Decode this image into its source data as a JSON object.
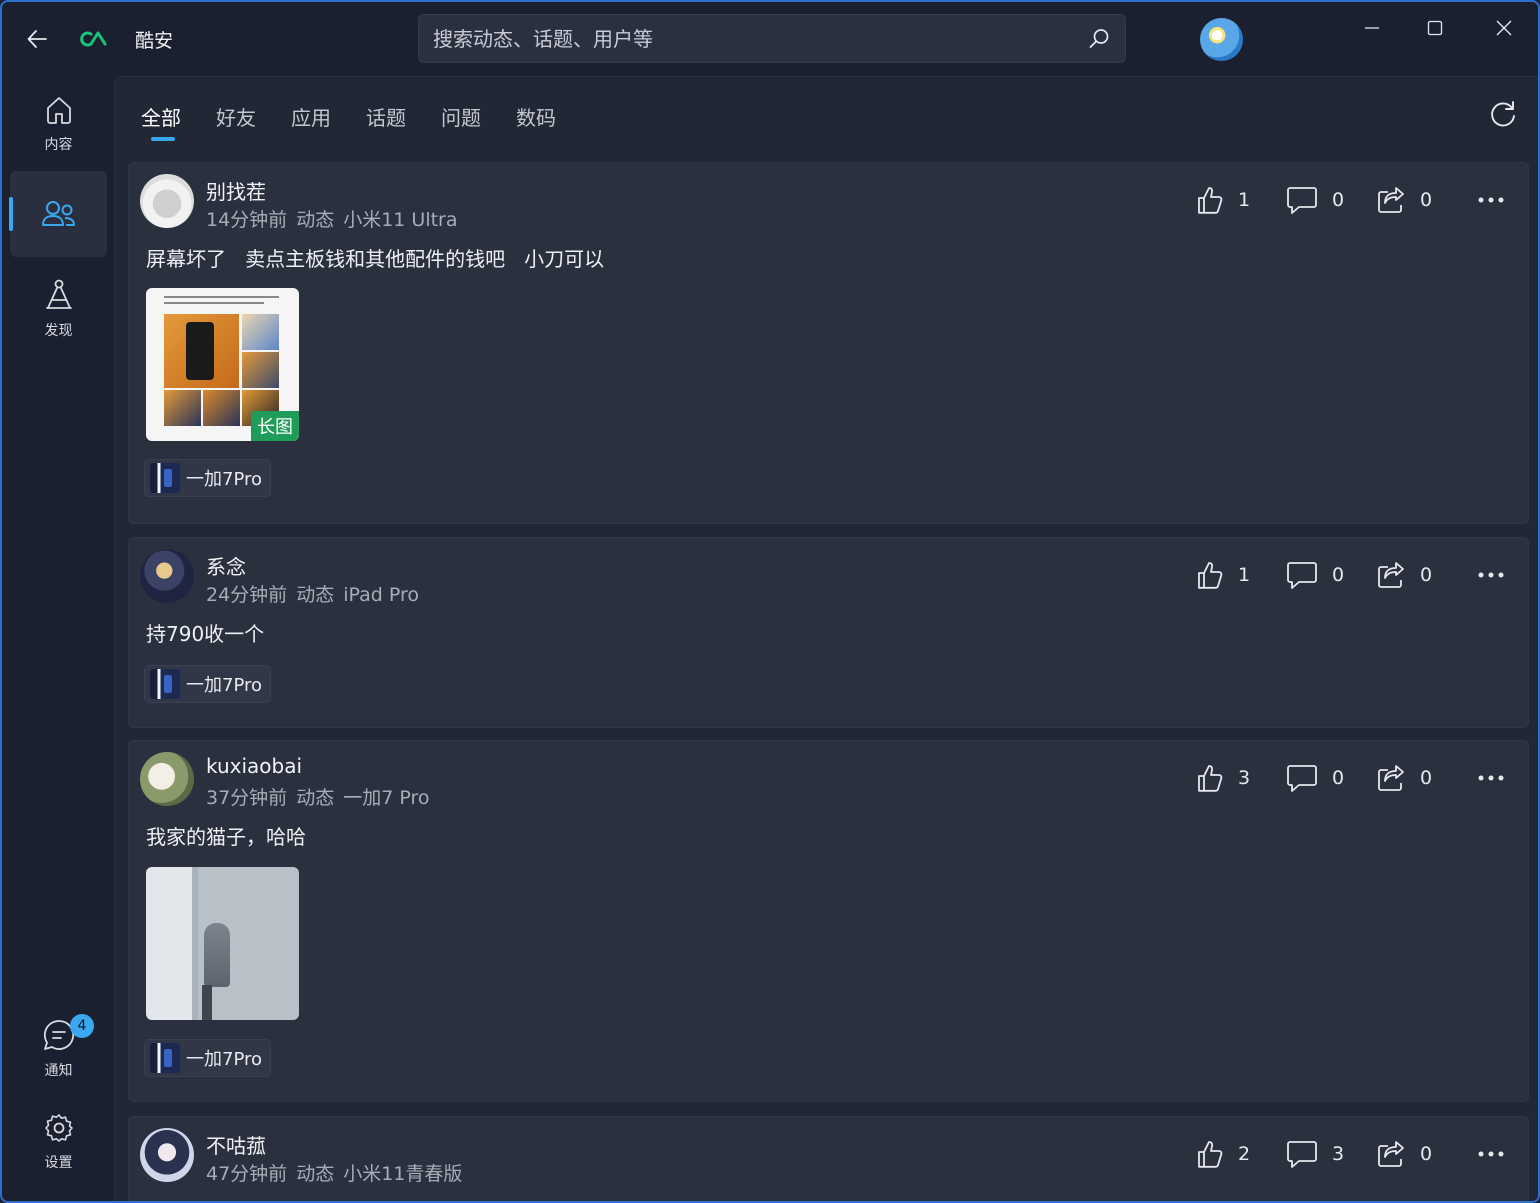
{
  "app": {
    "name": "酷安"
  },
  "search": {
    "placeholder": "搜索动态、话题、用户等"
  },
  "sidebar": {
    "items": [
      {
        "label": "内容",
        "icon": "home-icon"
      },
      {
        "label": "",
        "icon": "people-icon",
        "active": true
      },
      {
        "label": "发现",
        "icon": "discover-icon"
      }
    ],
    "bottom": [
      {
        "label": "通知",
        "icon": "chat-icon",
        "badge": "4"
      },
      {
        "label": "设置",
        "icon": "gear-icon"
      }
    ]
  },
  "tabs": [
    "全部",
    "好友",
    "应用",
    "话题",
    "问题",
    "数码"
  ],
  "posts": [
    {
      "user": "别找茬",
      "time": "14分钟前",
      "type": "动态",
      "device": "小米11 Ultra",
      "text": "屏幕坏了   卖点主板钱和其他配件的钱吧   小刀可以",
      "likes": "1",
      "comments": "0",
      "shares": "0",
      "image_tag": "长图",
      "chip": "一加7Pro"
    },
    {
      "user": "系念",
      "time": "24分钟前",
      "type": "动态",
      "device": "iPad Pro",
      "text": "持790收一个",
      "likes": "1",
      "comments": "0",
      "shares": "0",
      "chip": "一加7Pro"
    },
    {
      "user": "kuxiaobai",
      "time": "37分钟前",
      "type": "动态",
      "device": "一加7 Pro",
      "text": "我家的猫子，哈哈",
      "likes": "3",
      "comments": "0",
      "shares": "0",
      "chip": "一加7Pro"
    },
    {
      "user": "不咕菰",
      "time": "47分钟前",
      "type": "动态",
      "device": "小米11青春版",
      "text": "",
      "likes": "2",
      "comments": "3",
      "shares": "0"
    }
  ],
  "colors": {
    "accent": "#3aa7ef",
    "tag_green": "#1f9b5a",
    "window_border": "#2b6fd0"
  }
}
